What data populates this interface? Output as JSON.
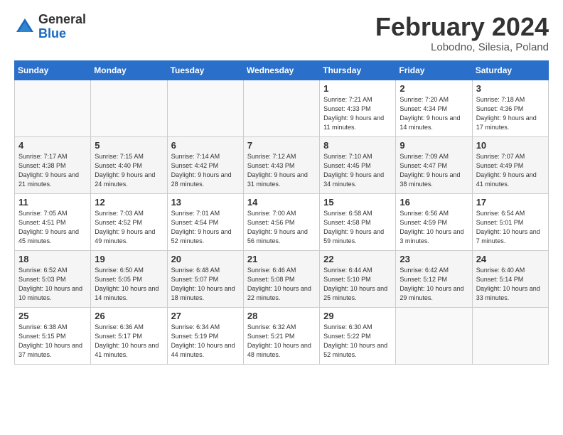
{
  "header": {
    "logo_general": "General",
    "logo_blue": "Blue",
    "title": "February 2024",
    "location": "Lobodno, Silesia, Poland"
  },
  "days_of_week": [
    "Sunday",
    "Monday",
    "Tuesday",
    "Wednesday",
    "Thursday",
    "Friday",
    "Saturday"
  ],
  "weeks": [
    [
      {
        "day": "",
        "info": ""
      },
      {
        "day": "",
        "info": ""
      },
      {
        "day": "",
        "info": ""
      },
      {
        "day": "",
        "info": ""
      },
      {
        "day": "1",
        "info": "Sunrise: 7:21 AM\nSunset: 4:33 PM\nDaylight: 9 hours\nand 11 minutes."
      },
      {
        "day": "2",
        "info": "Sunrise: 7:20 AM\nSunset: 4:34 PM\nDaylight: 9 hours\nand 14 minutes."
      },
      {
        "day": "3",
        "info": "Sunrise: 7:18 AM\nSunset: 4:36 PM\nDaylight: 9 hours\nand 17 minutes."
      }
    ],
    [
      {
        "day": "4",
        "info": "Sunrise: 7:17 AM\nSunset: 4:38 PM\nDaylight: 9 hours\nand 21 minutes."
      },
      {
        "day": "5",
        "info": "Sunrise: 7:15 AM\nSunset: 4:40 PM\nDaylight: 9 hours\nand 24 minutes."
      },
      {
        "day": "6",
        "info": "Sunrise: 7:14 AM\nSunset: 4:42 PM\nDaylight: 9 hours\nand 28 minutes."
      },
      {
        "day": "7",
        "info": "Sunrise: 7:12 AM\nSunset: 4:43 PM\nDaylight: 9 hours\nand 31 minutes."
      },
      {
        "day": "8",
        "info": "Sunrise: 7:10 AM\nSunset: 4:45 PM\nDaylight: 9 hours\nand 34 minutes."
      },
      {
        "day": "9",
        "info": "Sunrise: 7:09 AM\nSunset: 4:47 PM\nDaylight: 9 hours\nand 38 minutes."
      },
      {
        "day": "10",
        "info": "Sunrise: 7:07 AM\nSunset: 4:49 PM\nDaylight: 9 hours\nand 41 minutes."
      }
    ],
    [
      {
        "day": "11",
        "info": "Sunrise: 7:05 AM\nSunset: 4:51 PM\nDaylight: 9 hours\nand 45 minutes."
      },
      {
        "day": "12",
        "info": "Sunrise: 7:03 AM\nSunset: 4:52 PM\nDaylight: 9 hours\nand 49 minutes."
      },
      {
        "day": "13",
        "info": "Sunrise: 7:01 AM\nSunset: 4:54 PM\nDaylight: 9 hours\nand 52 minutes."
      },
      {
        "day": "14",
        "info": "Sunrise: 7:00 AM\nSunset: 4:56 PM\nDaylight: 9 hours\nand 56 minutes."
      },
      {
        "day": "15",
        "info": "Sunrise: 6:58 AM\nSunset: 4:58 PM\nDaylight: 9 hours\nand 59 minutes."
      },
      {
        "day": "16",
        "info": "Sunrise: 6:56 AM\nSunset: 4:59 PM\nDaylight: 10 hours\nand 3 minutes."
      },
      {
        "day": "17",
        "info": "Sunrise: 6:54 AM\nSunset: 5:01 PM\nDaylight: 10 hours\nand 7 minutes."
      }
    ],
    [
      {
        "day": "18",
        "info": "Sunrise: 6:52 AM\nSunset: 5:03 PM\nDaylight: 10 hours\nand 10 minutes."
      },
      {
        "day": "19",
        "info": "Sunrise: 6:50 AM\nSunset: 5:05 PM\nDaylight: 10 hours\nand 14 minutes."
      },
      {
        "day": "20",
        "info": "Sunrise: 6:48 AM\nSunset: 5:07 PM\nDaylight: 10 hours\nand 18 minutes."
      },
      {
        "day": "21",
        "info": "Sunrise: 6:46 AM\nSunset: 5:08 PM\nDaylight: 10 hours\nand 22 minutes."
      },
      {
        "day": "22",
        "info": "Sunrise: 6:44 AM\nSunset: 5:10 PM\nDaylight: 10 hours\nand 25 minutes."
      },
      {
        "day": "23",
        "info": "Sunrise: 6:42 AM\nSunset: 5:12 PM\nDaylight: 10 hours\nand 29 minutes."
      },
      {
        "day": "24",
        "info": "Sunrise: 6:40 AM\nSunset: 5:14 PM\nDaylight: 10 hours\nand 33 minutes."
      }
    ],
    [
      {
        "day": "25",
        "info": "Sunrise: 6:38 AM\nSunset: 5:15 PM\nDaylight: 10 hours\nand 37 minutes."
      },
      {
        "day": "26",
        "info": "Sunrise: 6:36 AM\nSunset: 5:17 PM\nDaylight: 10 hours\nand 41 minutes."
      },
      {
        "day": "27",
        "info": "Sunrise: 6:34 AM\nSunset: 5:19 PM\nDaylight: 10 hours\nand 44 minutes."
      },
      {
        "day": "28",
        "info": "Sunrise: 6:32 AM\nSunset: 5:21 PM\nDaylight: 10 hours\nand 48 minutes."
      },
      {
        "day": "29",
        "info": "Sunrise: 6:30 AM\nSunset: 5:22 PM\nDaylight: 10 hours\nand 52 minutes."
      },
      {
        "day": "",
        "info": ""
      },
      {
        "day": "",
        "info": ""
      }
    ]
  ]
}
